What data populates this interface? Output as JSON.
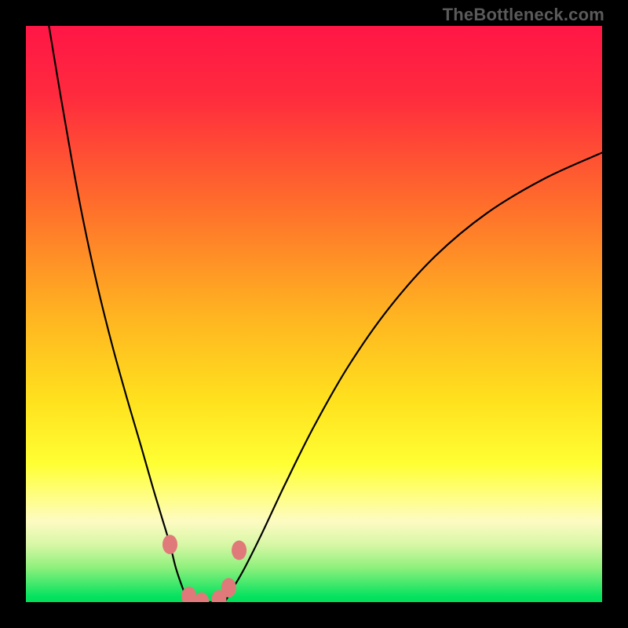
{
  "watermark": {
    "text": "TheBottleneck.com"
  },
  "colors": {
    "background": "#000000",
    "curve": "#000000",
    "dot_fill": "#e07a7a",
    "dot_stroke": "#c55a5a"
  },
  "chart_data": {
    "type": "line",
    "title": "",
    "xlabel": "",
    "ylabel": "",
    "xlim": [
      0,
      100
    ],
    "ylim": [
      0,
      100
    ],
    "legend": false,
    "grid": false,
    "gradient_stops": [
      {
        "offset": 0,
        "color": "#ff1646"
      },
      {
        "offset": 12,
        "color": "#ff2a3e"
      },
      {
        "offset": 30,
        "color": "#ff6a2c"
      },
      {
        "offset": 50,
        "color": "#ffb321"
      },
      {
        "offset": 65,
        "color": "#ffe11e"
      },
      {
        "offset": 76,
        "color": "#ffff33"
      },
      {
        "offset": 82,
        "color": "#fffe88"
      },
      {
        "offset": 86,
        "color": "#fdfbc2"
      },
      {
        "offset": 90,
        "color": "#d8f7a6"
      },
      {
        "offset": 94,
        "color": "#8ff07d"
      },
      {
        "offset": 97,
        "color": "#3de86b"
      },
      {
        "offset": 99,
        "color": "#06e25f"
      },
      {
        "offset": 100,
        "color": "#00df5b"
      }
    ],
    "series": [
      {
        "name": "left-branch",
        "x": [
          4.0,
          6.0,
          8.0,
          10.0,
          12.5,
          15.0,
          17.5,
          20.0,
          22.0,
          23.5,
          25.0,
          26.0,
          27.0,
          27.8,
          28.5
        ],
        "y": [
          100.0,
          88.0,
          76.5,
          66.0,
          54.5,
          44.5,
          35.5,
          27.0,
          20.0,
          15.0,
          10.0,
          6.0,
          3.0,
          1.0,
          0.0
        ]
      },
      {
        "name": "valley-floor",
        "x": [
          28.5,
          30.0,
          31.5,
          33.0,
          34.5
        ],
        "y": [
          0.0,
          0.0,
          0.0,
          0.0,
          0.0
        ]
      },
      {
        "name": "right-branch",
        "x": [
          34.5,
          36.0,
          38.0,
          41.0,
          45.0,
          50.0,
          56.0,
          63.0,
          71.0,
          80.0,
          90.0,
          100.0
        ],
        "y": [
          0.0,
          2.5,
          6.0,
          12.0,
          20.5,
          30.5,
          41.0,
          51.0,
          60.0,
          67.5,
          73.5,
          78.0
        ]
      }
    ],
    "dots": [
      {
        "x": 25.0,
        "y": 10.0,
        "r": 1.3
      },
      {
        "x": 28.3,
        "y": 1.0,
        "r": 1.3
      },
      {
        "x": 30.5,
        "y": 0.0,
        "r": 1.3
      },
      {
        "x": 33.5,
        "y": 0.4,
        "r": 1.3
      },
      {
        "x": 35.2,
        "y": 2.5,
        "r": 1.3
      },
      {
        "x": 37.0,
        "y": 9.0,
        "r": 1.3
      }
    ]
  }
}
